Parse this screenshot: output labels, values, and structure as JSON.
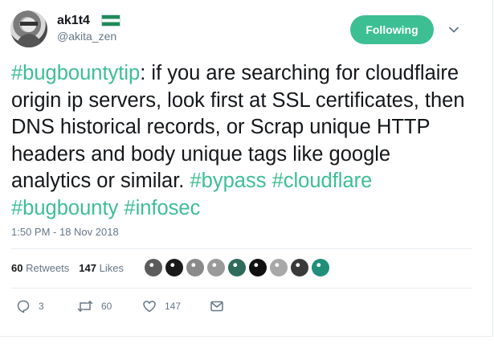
{
  "user": {
    "name": "ak1t4",
    "handle": "@akita_zen"
  },
  "follow_button": {
    "label": "Following"
  },
  "tweet": {
    "segments": [
      {
        "text": "#bugbountytip",
        "hashtag": true
      },
      {
        "text": ": if you are searching for cloudflaire origin ip servers, look first at SSL certificates, then DNS historical records, or Scrap unique HTTP headers and body unique tags like google analytics or similar. ",
        "hashtag": false
      },
      {
        "text": "#bypass",
        "hashtag": true
      },
      {
        "text": " ",
        "hashtag": false
      },
      {
        "text": "#cloudflare",
        "hashtag": true
      },
      {
        "text": " ",
        "hashtag": false
      },
      {
        "text": "#bugbounty",
        "hashtag": true
      },
      {
        "text": " ",
        "hashtag": false
      },
      {
        "text": "#infosec",
        "hashtag": true
      }
    ],
    "timestamp": "1:50 PM - 18 Nov 2018"
  },
  "stats": {
    "retweets_count": "60",
    "retweets_label": "Retweets",
    "likes_count": "147",
    "likes_label": "Likes"
  },
  "likers": [
    {
      "color": "#5b5b5b"
    },
    {
      "color": "#1a1a1a"
    },
    {
      "color": "#8a8a8a"
    },
    {
      "color": "#9a9a9a"
    },
    {
      "color": "#2f6b5a"
    },
    {
      "color": "#111111"
    },
    {
      "color": "#a8a8a8"
    },
    {
      "color": "#3a3a3a"
    },
    {
      "color": "#1f8f7a"
    }
  ],
  "actions": {
    "reply_count": "3",
    "retweet_count": "60",
    "like_count": "147"
  },
  "colors": {
    "accent": "#3cbf93",
    "muted": "#657786",
    "text": "#14171a",
    "divider": "#e6ecf0"
  },
  "icons": [
    "reply-icon",
    "retweet-icon",
    "like-icon",
    "message-icon",
    "chevron-down-icon",
    "flag-icon"
  ]
}
